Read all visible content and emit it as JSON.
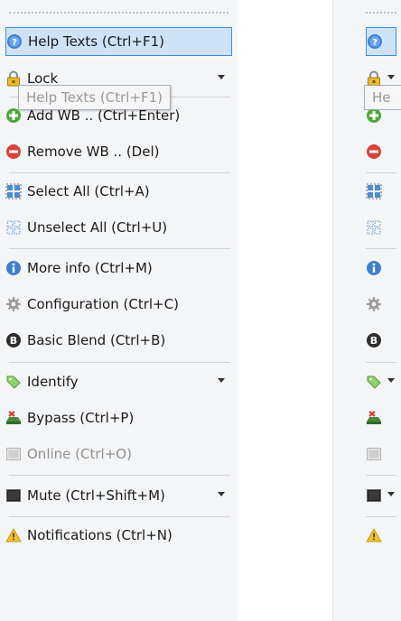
{
  "colors": {
    "selected_bg": "#cfe3f8",
    "selected_border": "#3d8ede",
    "disabled_text": "#8f8f8f",
    "toolbar_bg": "#f4f5f7"
  },
  "tooltip": {
    "text": "Help Texts (Ctrl+F1)",
    "compact_text": "He"
  },
  "toolbar": {
    "items": [
      {
        "id": "help",
        "label": "Help Texts (Ctrl+F1)",
        "icon": "help-icon",
        "selected": true,
        "dropdown": false
      },
      {
        "id": "lock",
        "label": "Lock",
        "icon": "lock-icon",
        "dropdown": true
      },
      {
        "id": "addwb",
        "label": "Add WB .. (Ctrl+Enter)",
        "icon": "add-icon",
        "dropdown": false
      },
      {
        "id": "removewb",
        "label": "Remove WB .. (Del)",
        "icon": "remove-icon",
        "dropdown": false
      },
      {
        "id": "selectall",
        "label": "Select All (Ctrl+A)",
        "icon": "select-all-icon",
        "dropdown": false
      },
      {
        "id": "unselectall",
        "label": "Unselect All (Ctrl+U)",
        "icon": "unselect-all-icon",
        "dropdown": false
      },
      {
        "id": "moreinfo",
        "label": "More info (Ctrl+M)",
        "icon": "info-icon",
        "dropdown": false
      },
      {
        "id": "config",
        "label": "Configuration (Ctrl+C)",
        "icon": "gear-icon",
        "dropdown": false
      },
      {
        "id": "basicblend",
        "label": "Basic Blend (Ctrl+B)",
        "icon": "blend-b-icon",
        "dropdown": false
      },
      {
        "id": "identify",
        "label": "Identify",
        "icon": "tag-icon",
        "dropdown": true
      },
      {
        "id": "bypass",
        "label": "Bypass (Ctrl+P)",
        "icon": "bypass-icon",
        "dropdown": false
      },
      {
        "id": "online",
        "label": "Online (Ctrl+O)",
        "icon": "online-icon",
        "disabled": true,
        "dropdown": false
      },
      {
        "id": "mute",
        "label": "Mute (Ctrl+Shift+M)",
        "icon": "mute-icon",
        "dropdown": true
      },
      {
        "id": "notifications",
        "label": "Notifications (Ctrl+N)",
        "icon": "warning-icon",
        "dropdown": false
      }
    ]
  }
}
